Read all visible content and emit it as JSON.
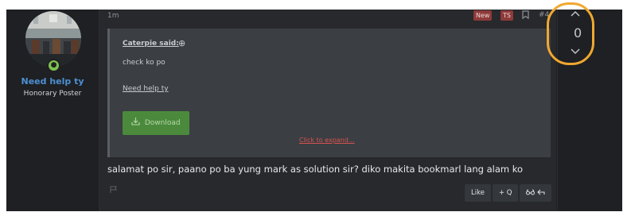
{
  "user": {
    "name": "Need help ty",
    "title": "Honorary Poster"
  },
  "post": {
    "time": "1m",
    "badge_new": "New",
    "badge_ts": "TS",
    "number": "#4",
    "body": "salamat po sir, paano po ba yung mark as solution sir? diko makita bookmarl lang alam ko"
  },
  "quote": {
    "author": "Caterpie said:",
    "text": "check ko po",
    "link": "Need help ty",
    "download": "Download",
    "expand": "Click to expand..."
  },
  "actions": {
    "like": "Like",
    "quote": "+ Q"
  },
  "vote": {
    "count": "0"
  },
  "icons": {
    "bookmark": "bookmark-icon",
    "report": "flag-icon",
    "upvote": "chevron-up-icon",
    "downvote": "chevron-down-icon",
    "download": "download-icon",
    "reply": "reply-icon",
    "glasses": "glasses-icon"
  },
  "colors": {
    "accent_username": "#4d8fd2",
    "download_button": "#4b8a3d",
    "expand_link": "#d9534f",
    "badge": "#8d3a3a",
    "annotation_highlight": "#f0a830"
  }
}
